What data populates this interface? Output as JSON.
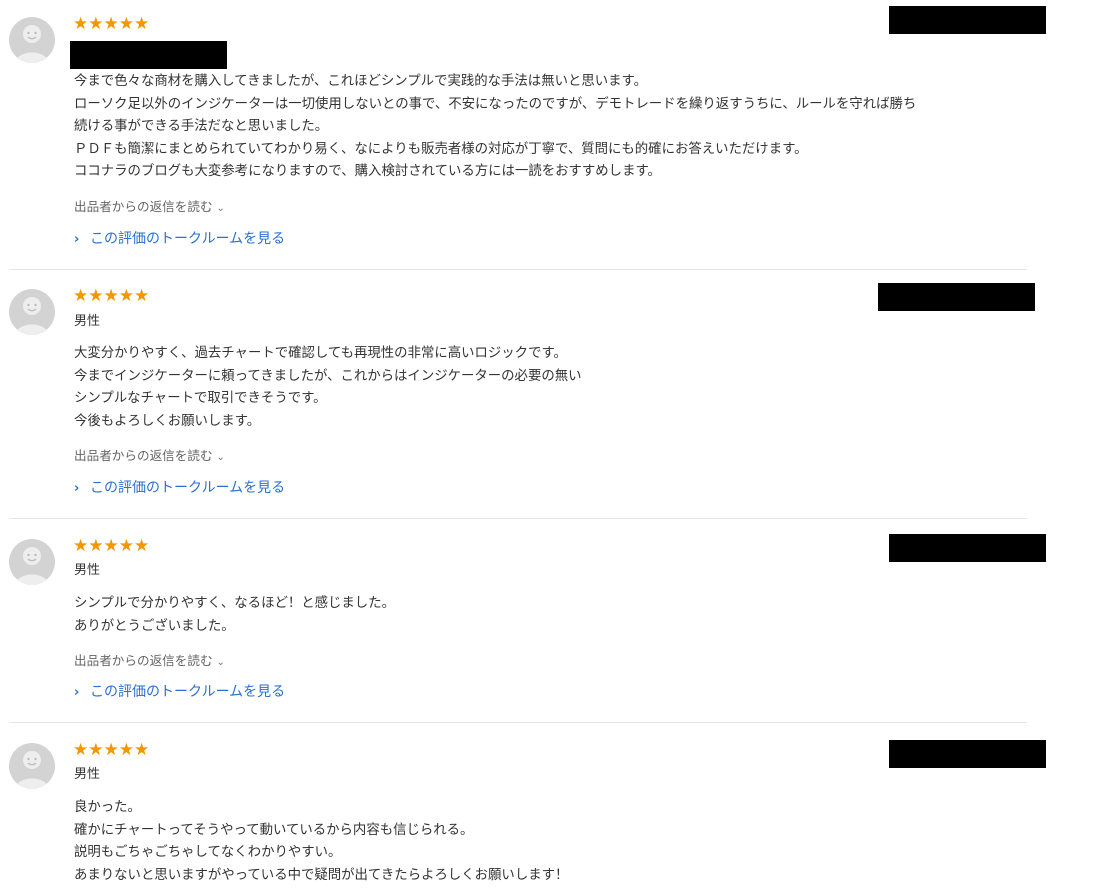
{
  "colors": {
    "star": "#f29602",
    "link": "#2a6fd1",
    "divider": "#e6e6e6",
    "avatar": "#d3d3d3"
  },
  "reviews": [
    {
      "rating": 5,
      "stars": "★★★★★",
      "gender": "",
      "body": "今まで色々な商材を購入してきましたが、これほどシンプルで実践的な手法は無いと思います。\nローソク足以外のインジケーターは一切使用しないとの事で、不安になったのですが、デモトレードを繰り返すうちに、ルールを守れば勝ち\n続ける事ができる手法だなと思いました。\nＰＤＦも簡潔にまとめられていてわかり易く、なによりも販売者様の対応が丁寧で、質問にも的確にお答えいただけます。\nココナラのブログも大変参考になりますので、購入検討されている方には一読をおすすめします。",
      "reply_label": "出品者からの返信を読む",
      "talk_label": "この評価のトークルームを見る"
    },
    {
      "rating": 5,
      "stars": "★★★★★",
      "gender": "男性",
      "body": "大変分かりやすく、過去チャートで確認しても再現性の非常に高いロジックです。\n今までインジケーターに頼ってきましたが、これからはインジケーターの必要の無い\nシンプルなチャートで取引できそうです。\n今後もよろしくお願いします。",
      "reply_label": "出品者からの返信を読む",
      "talk_label": "この評価のトークルームを見る"
    },
    {
      "rating": 5,
      "stars": "★★★★★",
      "gender": "男性",
      "body": "シンプルで分かりやすく、なるほど！と感じました。\nありがとうございました。",
      "reply_label": "出品者からの返信を読む",
      "talk_label": "この評価のトークルームを見る"
    },
    {
      "rating": 5,
      "stars": "★★★★★",
      "gender": "男性",
      "body": "良かった。\n確かにチャートってそうやって動いているから内容も信じられる。\n説明もごちゃごちゃしてなくわかりやすい。\nあまりないと思いますがやっている中で疑問が出てきたらよろしくお願いします！",
      "reply_label": "",
      "talk_label": ""
    }
  ]
}
